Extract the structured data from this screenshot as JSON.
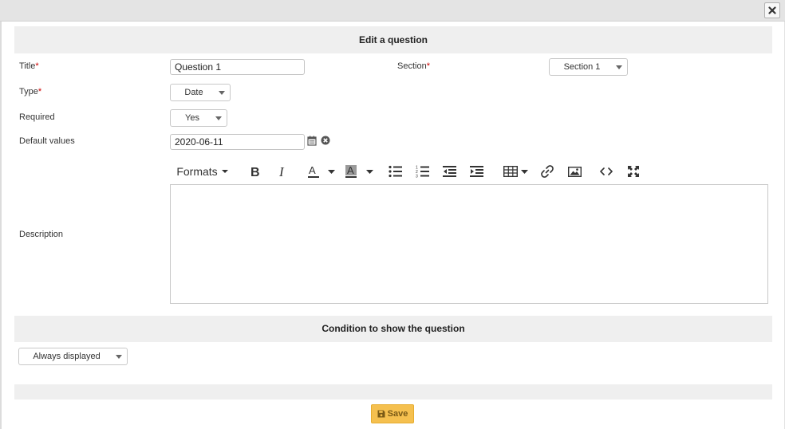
{
  "dialog": {
    "close_icon": "close-icon",
    "header_title": "Edit a question"
  },
  "form": {
    "title": {
      "label": "Title",
      "required_mark": "*",
      "value": "Question 1"
    },
    "section": {
      "label": "Section",
      "required_mark": "*",
      "value": "Section 1"
    },
    "type": {
      "label": "Type",
      "required_mark": "*",
      "value": "Date"
    },
    "required": {
      "label": "Required",
      "value": "Yes"
    },
    "default_values": {
      "label": "Default values",
      "value": "2020-06-11",
      "calendar_icon": "calendar-icon",
      "clear_icon": "clear-circle-icon"
    },
    "description": {
      "label": "Description",
      "value": ""
    }
  },
  "toolbar": {
    "formats_label": "Formats",
    "buttons": [
      "bold-icon",
      "italic-icon",
      "text-color-icon",
      "background-color-icon",
      "bullet-list-icon",
      "numbered-list-icon",
      "outdent-icon",
      "indent-icon",
      "table-icon",
      "link-icon",
      "image-icon",
      "source-code-icon",
      "fullscreen-icon"
    ]
  },
  "condition": {
    "header_title": "Condition to show the question",
    "value": "Always displayed"
  },
  "footer": {
    "save_label": "Save",
    "save_icon": "floppy-disk-icon"
  },
  "colors": {
    "band_bg": "#efefef",
    "save_bg": "#f5c04f",
    "required_mark": "#cc0000"
  }
}
